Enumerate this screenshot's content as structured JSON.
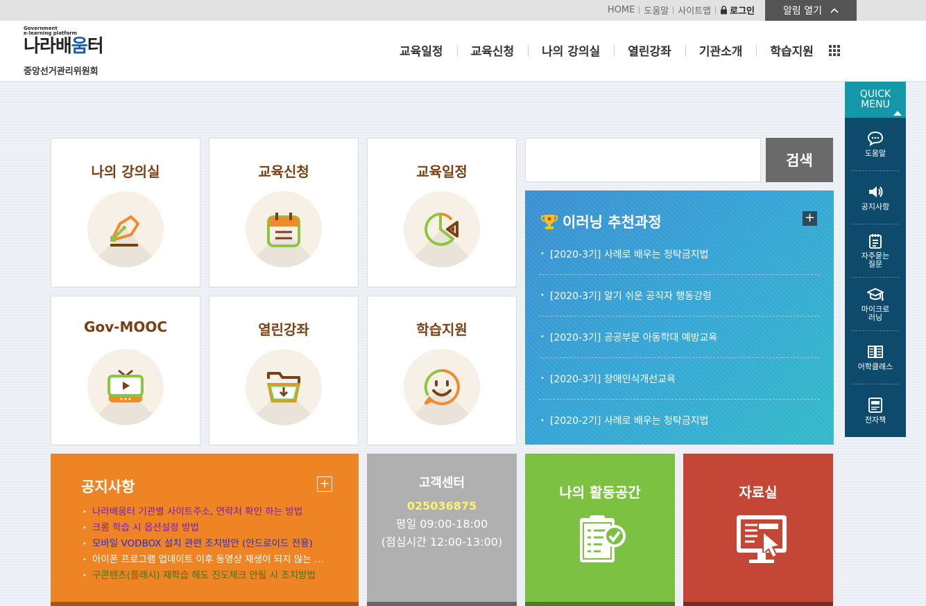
{
  "topbar": {
    "home": "HOME",
    "help": "도움말",
    "sitemap": "사이트맵",
    "login": "로그인",
    "alarm": "알림 열기"
  },
  "header": {
    "logo_small_1": "Government",
    "logo_small_2": "e-learning platform",
    "logo_main_a": "나라배",
    "logo_main_b": "움",
    "logo_main_c": "터",
    "org": "중앙선거관리위원회"
  },
  "gnb": [
    "교육일정",
    "교육신청",
    "나의 강의실",
    "열린강좌",
    "기관소개",
    "학습지원"
  ],
  "tiles": {
    "classroom": "나의 강의실",
    "apply": "교육신청",
    "schedule": "교육일정",
    "mooc": "Gov-MOOC",
    "open": "열린강좌",
    "support": "학습지원"
  },
  "search": {
    "button": "검색",
    "value": ""
  },
  "recommended": {
    "title": "이러닝 추천과정",
    "items": [
      "[2020-3기] 사례로 배우는 청탁금지법",
      "[2020-3기] 알기 쉬운 공직자 행동강령",
      "[2020-3기] 공공부문 아동학대 예방교육",
      "[2020-3기] 장애인식개선교육",
      "[2020-2기] 사례로 배우는 청탁금지법"
    ]
  },
  "notice": {
    "title": "공지사항",
    "items": [
      {
        "text": "나라배움터 기관별 사이트주소, 연락처 확인 하는 방법",
        "color": "#7a1fb0"
      },
      {
        "text": "크롬 학습 시 옵션설정 방법",
        "color": "#7a1fb0"
      },
      {
        "text": "모바일 VODBOX 설치 관련 조치방안 (안드로이드 전용)",
        "color": "#2a2ad8"
      },
      {
        "text": "아이폰 프로그램 업데이트 이후 동영상 재생이 되지 않는 경우",
        "color": "#ffffff"
      },
      {
        "text": "구콘텐츠(플래시) 재학습 해도 진도체크 안될 시 조치방법",
        "color": "#3a7a18"
      }
    ]
  },
  "customer": {
    "title": "고객센터",
    "phone": "025036875",
    "hours": "평일 09:00-18:00",
    "lunch": "(점심시간 12:00-13:00)"
  },
  "activity": {
    "title": "나의 활동공간"
  },
  "archive": {
    "title": "자료실"
  },
  "quick": {
    "header": [
      "QUICK",
      "MENU"
    ],
    "items": [
      {
        "label": "도움말",
        "icon": "chat-icon"
      },
      {
        "label": "공지사항",
        "icon": "speaker-icon"
      },
      {
        "label": "자주묻는\n질문",
        "icon": "faq-icon"
      },
      {
        "label": "마이크로\n러닝",
        "icon": "graduation-cap-icon"
      },
      {
        "label": "어학클래스",
        "icon": "book-icon"
      },
      {
        "label": "전자책",
        "icon": "ebook-icon"
      }
    ]
  },
  "colors": {
    "notice_bg": "#ee8424",
    "customer_bg": "#b0b0b0",
    "activity_bg": "#7dc143",
    "archive_bg": "#c44636",
    "quick_bg": "#0e4a6b",
    "tile_title": "#7a3f12"
  }
}
